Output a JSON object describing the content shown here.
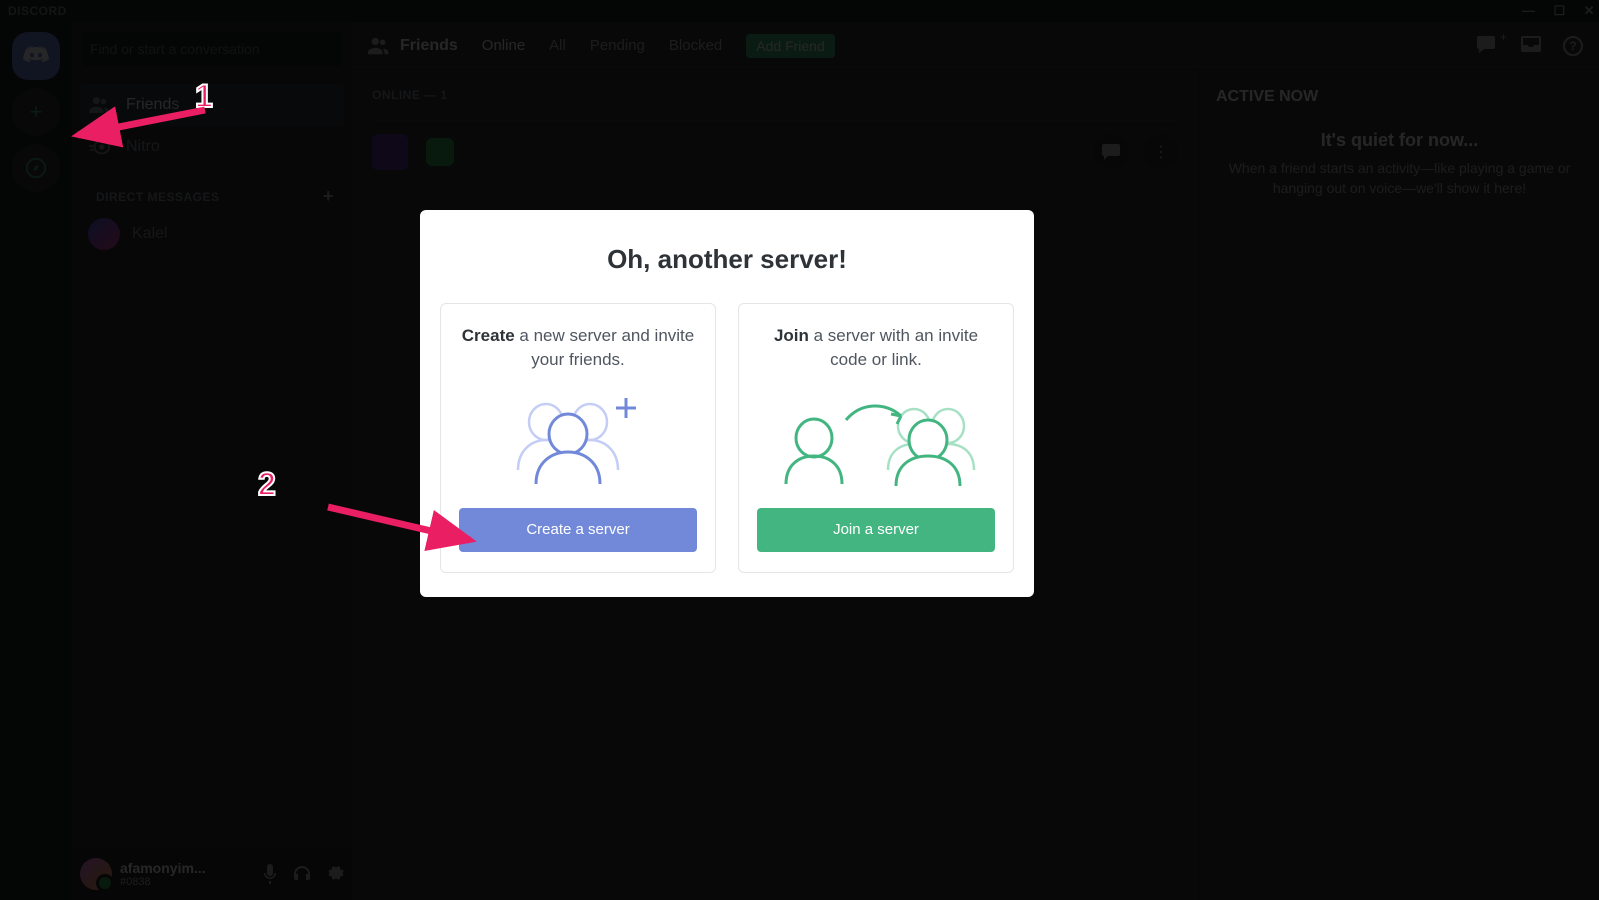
{
  "titlebar": {
    "app": "DISCORD"
  },
  "dm": {
    "search_placeholder": "Find or start a conversation",
    "friends_label": "Friends",
    "nitro_label": "Nitro",
    "dm_header": "DIRECT MESSAGES",
    "friend_name": "Kalel"
  },
  "user_panel": {
    "name": "afamonyim...",
    "discriminator": "#0838"
  },
  "topbar": {
    "title": "Friends",
    "tabs": {
      "online": "Online",
      "all": "All",
      "pending": "Pending",
      "blocked": "Blocked"
    },
    "add_friend": "Add Friend"
  },
  "friends_list": {
    "section": "ONLINE — 1"
  },
  "active_now": {
    "title": "ACTIVE NOW",
    "quiet": "It's quiet for now...",
    "desc": "When a friend starts an activity—like playing a game or hanging out on voice—we'll show it here!"
  },
  "modal": {
    "title": "Oh, another server!",
    "create": {
      "strong": "Create",
      "rest": " a new server and invite your friends.",
      "button": "Create a server"
    },
    "join": {
      "strong": "Join",
      "rest": " a server with an invite code or link.",
      "button": "Join a server"
    }
  },
  "annotations": {
    "one": "1",
    "two": "2"
  }
}
